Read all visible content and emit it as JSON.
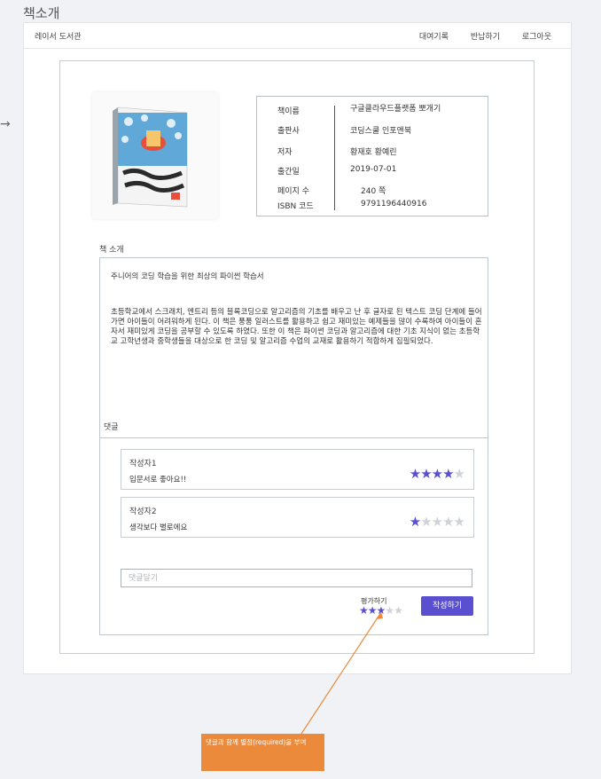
{
  "page": {
    "title": "책소개"
  },
  "nav": {
    "brand": "레이서 도서관",
    "links": [
      "대여기록",
      "반납하기",
      "로그아웃"
    ]
  },
  "book": {
    "fields": [
      {
        "label": "책이름",
        "value": "구글클라우드플랫폼 뽀개기"
      },
      {
        "label": "출판사",
        "value": "코딩스쿨 인포앤북"
      },
      {
        "label": "저자",
        "value": "황재호 황예린"
      },
      {
        "label": "출간일",
        "value": "2019-07-01"
      },
      {
        "label": "페이지 수",
        "value": "240 쪽"
      },
      {
        "label": "ISBN 코드",
        "value": "9791196440916"
      }
    ]
  },
  "intro": {
    "label": "책 소개",
    "headline": "주니어의 코딩 학습을 위한 최상의 파이썬 학습서",
    "body": "초등학교에서 스크래치, 엔트리 등의 블록코딩으로 알고리즘의 기초를 배우고 난 후 글자로 된 텍스트 코딩 단계에 들어가면 아이들이 어려워하게 된다. 이 책은 풍풍 일러스트를 활용하고 쉽고 재미있는 예제들을 많이 수록하여 아이들이 혼자서 재미있게 코딩을 공부할 수 있도록 하였다. 또한 이 책은 파이썬 코딩과 알고리즘에 대한 기초 지식이 없는 초등학교 고학년생과 중학생들을 대상으로 한 코딩 및 알고리즘 수업의 교재로 활용하기 적합하게 집필되었다."
  },
  "comments": {
    "label": "댓글",
    "items": [
      {
        "author": "작성자1",
        "text": "입문서로 좋아요!!",
        "rating": 4,
        "max": 5
      },
      {
        "author": "작성자2",
        "text": "생각보다 별로에요",
        "rating": 1,
        "max": 5
      }
    ],
    "input_placeholder": "댓글달기",
    "rating_label": "평가하기",
    "rating_selected": 3,
    "submit_label": "작성하기"
  },
  "annotation": {
    "text": "댓글과 함께 별점(required)을 부여"
  },
  "colors": {
    "accent": "#5a4fcf",
    "star_off": "#cfd3d8",
    "annotation": "#ec8a3c"
  }
}
